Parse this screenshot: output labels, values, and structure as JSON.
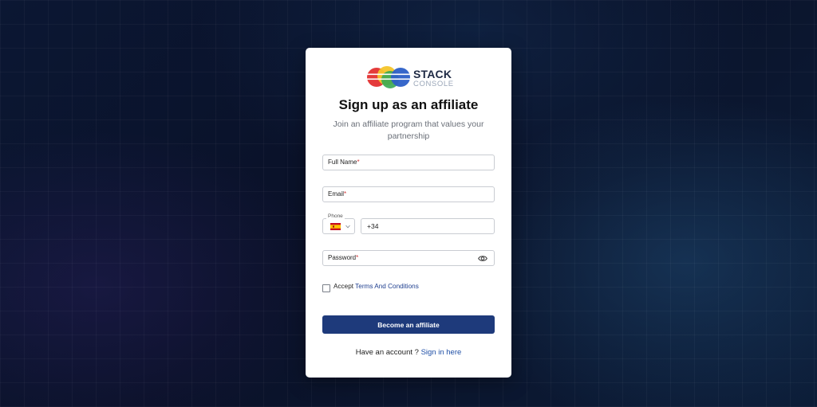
{
  "brand": {
    "name": "STACK",
    "sub": "CONSOLE",
    "logo_colors": [
      "#e43b3b",
      "#f4c52a",
      "#38a852",
      "#2c5fc7"
    ]
  },
  "signup": {
    "title": "Sign up as an affiliate",
    "subtitle": "Join an affiliate program that values your partnership",
    "fields": {
      "full_name": {
        "label": "Full Name",
        "required": "*"
      },
      "email": {
        "label": "Email",
        "required": "*"
      },
      "phone": {
        "label": "Phone",
        "country_code": "+34",
        "country_flag": "spain-flag-icon"
      },
      "password": {
        "label": "Password",
        "required": "*",
        "toggle_icon": "eye-icon"
      }
    },
    "terms": {
      "prefix": "Accept ",
      "link": "Terms And Conditions"
    },
    "submit_label": "Become an affiliate",
    "signin_prompt": "Have an account ? ",
    "signin_link": "Sign in here"
  },
  "colors": {
    "primary": "#1e3a7b",
    "link": "#1f4fa6",
    "required": "#d23a3a",
    "background": "#0b1733"
  }
}
